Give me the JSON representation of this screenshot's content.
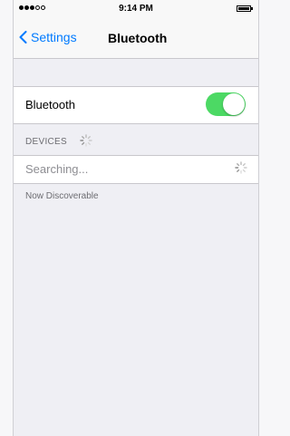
{
  "status_bar": {
    "time": "9:14 PM",
    "signal": "●●●○○",
    "battery_icon": "battery-full-icon"
  },
  "nav": {
    "back_label": "Settings",
    "title": "Bluetooth"
  },
  "bluetooth_row": {
    "label": "Bluetooth",
    "toggle_on": true,
    "toggle_color": "#4cd964"
  },
  "devices": {
    "header": "DEVICES",
    "searching": "Searching...",
    "footer": "Now Discoverable"
  },
  "colors": {
    "accent": "#007aff",
    "background": "#efeff4"
  }
}
